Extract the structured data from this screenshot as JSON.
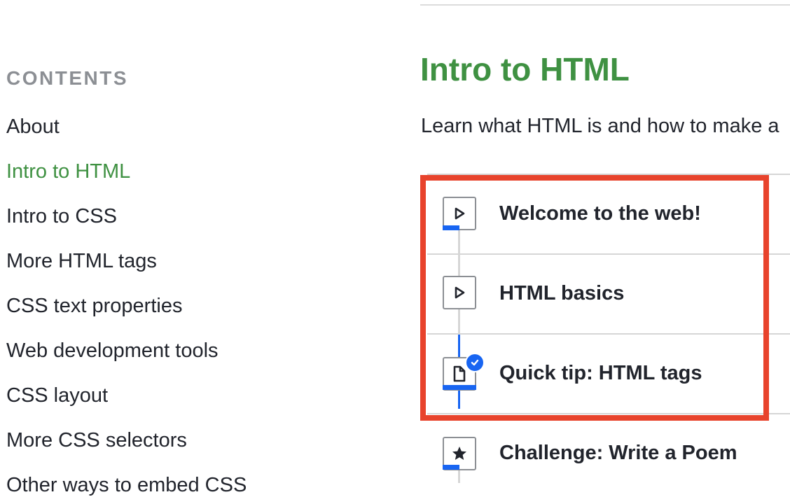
{
  "sidebar": {
    "heading": "CONTENTS",
    "items": [
      {
        "label": "About",
        "active": false
      },
      {
        "label": "Intro to HTML",
        "active": true
      },
      {
        "label": "Intro to CSS",
        "active": false
      },
      {
        "label": "More HTML tags",
        "active": false
      },
      {
        "label": "CSS text properties",
        "active": false
      },
      {
        "label": "Web development tools",
        "active": false
      },
      {
        "label": "CSS layout",
        "active": false
      },
      {
        "label": "More CSS selectors",
        "active": false
      },
      {
        "label": "Other ways to embed CSS",
        "active": false
      }
    ]
  },
  "main": {
    "title": "Intro to HTML",
    "description": "Learn what HTML is and how to make a",
    "lessons": [
      {
        "title": "Welcome to the web!",
        "icon": "play-icon",
        "progress": 0.5,
        "completed": false
      },
      {
        "title": "HTML basics",
        "icon": "play-icon",
        "progress": 0,
        "completed": false
      },
      {
        "title": "Quick tip: HTML tags",
        "icon": "article-icon",
        "progress": 1,
        "completed": true
      },
      {
        "title": "Challenge: Write a Poem",
        "icon": "star-icon",
        "progress": 0.5,
        "completed": false
      }
    ]
  },
  "colors": {
    "accent_green": "#3f9142",
    "progress_blue": "#1865f2",
    "highlight_red": "#e8432c"
  }
}
